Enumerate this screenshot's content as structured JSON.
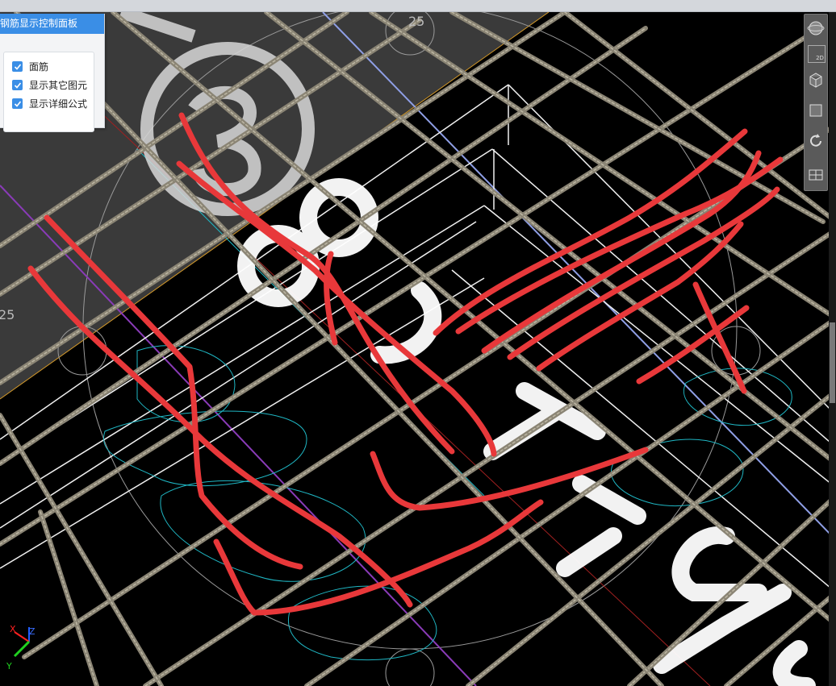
{
  "panel": {
    "title": "钢筋显示控制面板",
    "options": [
      {
        "label": "面筋",
        "checked": true
      },
      {
        "label": "显示其它图元",
        "checked": true
      },
      {
        "label": "显示详细公式",
        "checked": true
      }
    ]
  },
  "viewport": {
    "axis_labels": {
      "top": "25",
      "left": "25"
    },
    "annotation_color": "#e8383a",
    "rebar_color": "#8a8474"
  },
  "toolbar": {
    "icons": [
      "navigation-sphere-icon",
      "view-2d-icon",
      "view-3d-box-icon",
      "view-side-icon",
      "rotate-icon",
      "grid-layout-icon"
    ],
    "view_2d_label": "2D"
  },
  "axes": {
    "x": "X",
    "y": "Y",
    "z": "Z"
  }
}
